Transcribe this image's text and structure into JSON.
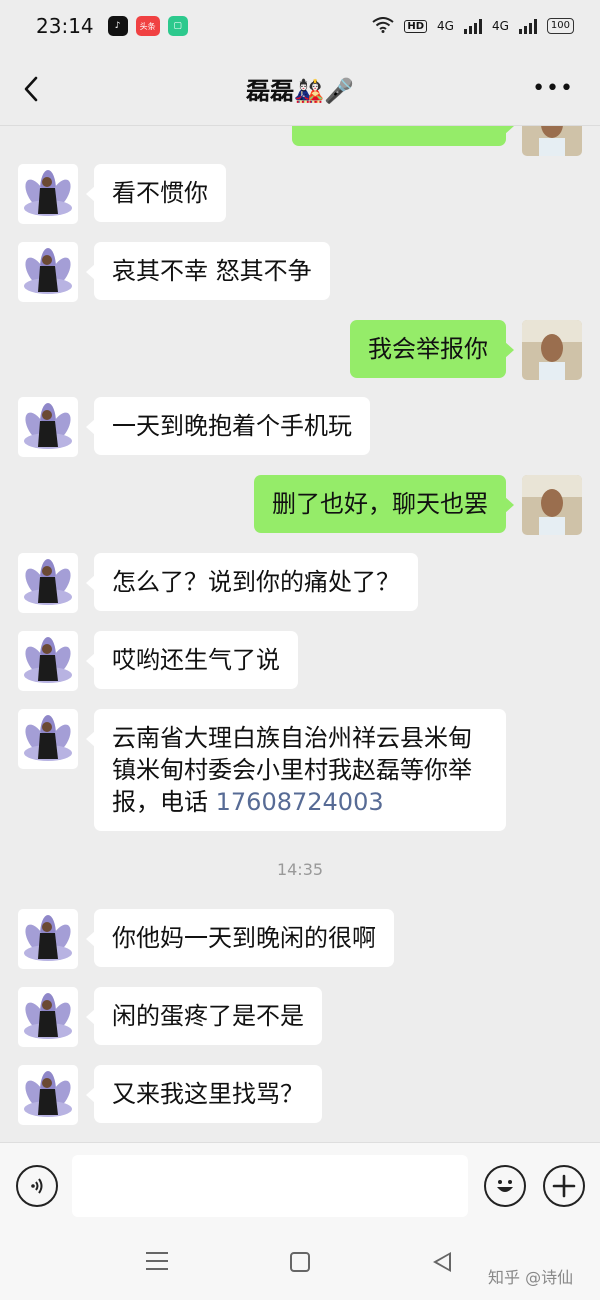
{
  "status_bar": {
    "time": "23:14",
    "app_toutiao": "头条",
    "hd_label": "HD",
    "network_1": "4G",
    "network_2": "4G",
    "battery": "100"
  },
  "header": {
    "title": "磊磊🎎🎤",
    "more_label": "•••"
  },
  "chat": {
    "messages": [
      {
        "side": "left",
        "text": "看不惯你"
      },
      {
        "side": "left",
        "text": "哀其不幸 怒其不争"
      },
      {
        "side": "right",
        "text": "我会举报你"
      },
      {
        "side": "left",
        "text": "一天到晚抱着个手机玩"
      },
      {
        "side": "right",
        "text": "删了也好，聊天也罢"
      },
      {
        "side": "left",
        "text": "怎么了？说到你的痛处了？"
      },
      {
        "side": "left",
        "text": "哎哟还生气了说"
      },
      {
        "side": "left",
        "text": "云南省大理白族自治州祥云县米甸",
        "line2": "镇米甸村委会小里村我赵磊等你举",
        "line3_prefix": "报，电话 ",
        "phone": "17608724003"
      },
      {
        "side": "left",
        "text": "你他妈一天到晚闲的很啊"
      },
      {
        "side": "left",
        "text": "闲的蛋疼了是不是"
      },
      {
        "side": "left",
        "text": "又来我这里找骂？"
      }
    ],
    "timestamp": "14:35"
  },
  "watermark": "知乎 @诗仙",
  "colors": {
    "background": "#ededed",
    "bubble_self": "#95ec69",
    "bubble_other": "#ffffff",
    "phone_link": "#576b95"
  },
  "icons": {
    "back": "chevron-left-icon",
    "voice": "voice-icon",
    "emoji": "smiley-icon",
    "plus": "plus-icon",
    "nav_menu": "menu-icon",
    "nav_home": "home-square-icon",
    "nav_back": "back-triangle-icon"
  }
}
